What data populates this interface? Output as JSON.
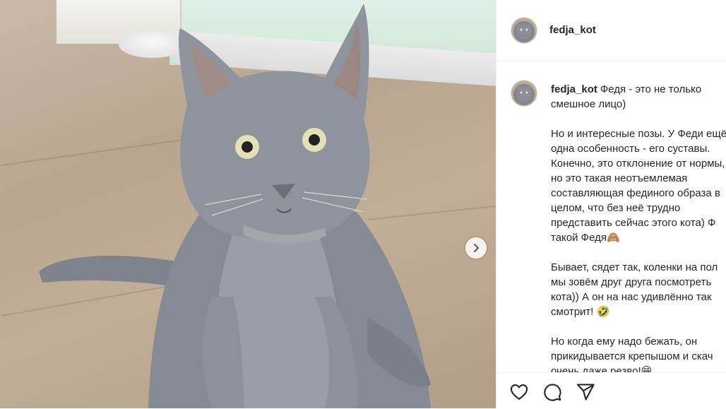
{
  "post": {
    "username": "fedja_kot",
    "next_icon": "chevron-right-icon"
  },
  "caption": {
    "username": "fedja_kot",
    "lines": [
      [
        "Федя - это не только",
        "смешное лицо)"
      ],
      [
        "Но и интересные позы. У Феди ещё",
        "одна особенность - его суставы.",
        "Конечно, это отклонение от нормы,",
        "но это такая неотъемлемая",
        "составляющая фединого образа в",
        "целом, что без неё трудно",
        "представить сейчас этого кота) Ф",
        "такой Федя🙈"
      ],
      [
        "Бывает, сядет так, коленки на пол",
        "мы зовём друг друга посмотреть",
        "кота)) А он на нас удивлённо так",
        "смотрит! 🤣"
      ],
      [
        "Но когда ему надо бежать, он",
        "прикидывается крепышом и скач",
        "очень даже резво!😁"
      ]
    ]
  },
  "actions": {
    "like_icon": "heart-icon",
    "comment_icon": "comment-icon",
    "share_icon": "share-paper-plane-icon"
  }
}
